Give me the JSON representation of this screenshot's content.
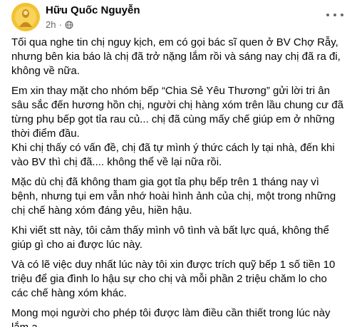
{
  "header": {
    "author": "Hữu Quốc Nguyễn",
    "time": "2h",
    "separator": "·",
    "privacy_icon": "globe-icon",
    "more_icon": "more-options-icon"
  },
  "post": {
    "paragraphs": [
      "Tối qua nghe tin chị nguy kịch, em có gọi bác sĩ quen ở BV Chợ Rẫy, nhưng bên kia báo là chị đã trở nặng lắm rồi và sáng nay chị đã ra đi, không về nữa.",
      "Em xin thay mặt cho nhóm bếp “Chia Sẻ Yêu Thương” gửi lời tri ân sâu sắc đến hương hồn chị, người chị hàng xóm trên lầu chung cư đã từng phụ bếp gọt tỉa rau củ... chị đã cùng mấy chế giúp em ở những thời điểm đầu.\nKhi chị thấy có vấn đề, chị đã tự mình ý thức cách ly tại nhà, đến khi vào BV thì chị đã.... không thể về lại nữa rồi.",
      "Mặc dù chị đã không tham gia gọt tỉa phụ bếp trên 1 tháng nay vì bệnh, nhưng tụi em vẫn nhớ hoài hình ảnh của chị, một trong những chị chế hàng xóm đáng yêu, hiền hậu.",
      "Khi viết stt này, tôi cảm thấy mình vô tình và bất lực quá, không thể giúp gì cho ai được lúc này.",
      "Và có lẽ việc duy nhất lúc này tôi xin được trích quỹ bếp 1 số tiền 10 triệu để gia đình lo hậu sự cho chị và mỗi phần 2 triệu chăm lo cho các chế hàng xóm khác.",
      "Mong mọi người cho phép tôi được làm điều cần thiết trong lúc này lắm ạ."
    ]
  }
}
